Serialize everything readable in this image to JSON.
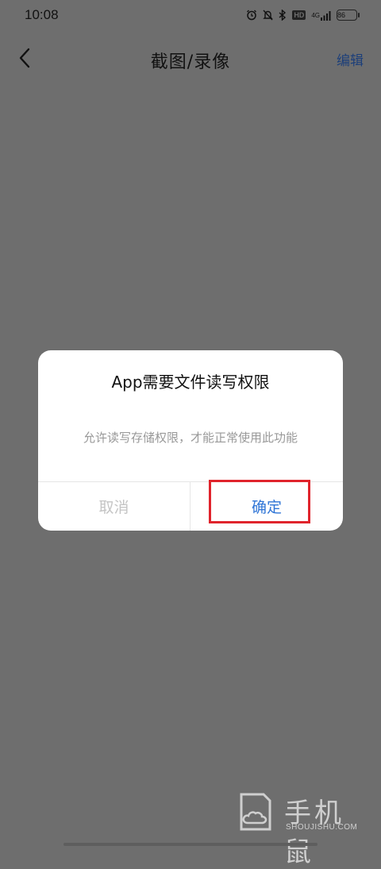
{
  "status_bar": {
    "time": "10:08",
    "icons": [
      "alarm-icon",
      "mute-icon",
      "bluetooth-icon",
      "hd-icon",
      "4g-signal-icon",
      "battery-icon"
    ],
    "hd_label": "HD",
    "network": "4G",
    "battery": "86"
  },
  "header": {
    "title": "截图/录像",
    "edit_label": "编辑"
  },
  "dialog": {
    "title": "App需要文件读写权限",
    "message": "允许读写存储权限，才能正常使用此功能",
    "cancel_label": "取消",
    "confirm_label": "确定"
  },
  "watermark": {
    "text": "手机鼠",
    "sub": "SHOUJISHU.COM"
  },
  "colors": {
    "overlay": "#6e6e6e",
    "accent": "#2f75d6",
    "highlight": "#e0242c"
  }
}
